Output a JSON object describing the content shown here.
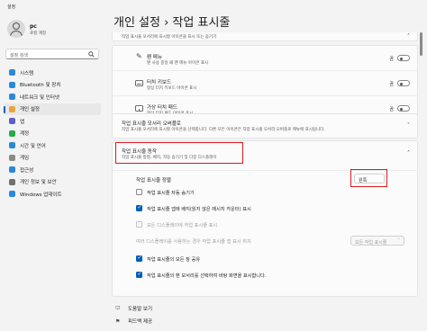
{
  "window": {
    "title": "설정"
  },
  "profile": {
    "name": "pc",
    "type": "로컬 계정"
  },
  "search": {
    "placeholder": "설정 검색"
  },
  "nav": [
    {
      "label": "시스템",
      "color": "#2b88d8"
    },
    {
      "label": "Bluetooth 및 장치",
      "color": "#2b88d8"
    },
    {
      "label": "네트워크 및 인터넷",
      "color": "#2b88d8"
    },
    {
      "label": "개인 설정",
      "color": "#e8a33d",
      "active": true
    },
    {
      "label": "앱",
      "color": "#5b5fc7"
    },
    {
      "label": "계정",
      "color": "#2aa84a"
    },
    {
      "label": "시간 및 언어",
      "color": "#2b88d8"
    },
    {
      "label": "게임",
      "color": "#8a8a8a"
    },
    {
      "label": "접근성",
      "color": "#2b88d8"
    },
    {
      "label": "개인 정보 및 보안",
      "color": "#707070"
    },
    {
      "label": "Windows 업데이트",
      "color": "#2b88d8"
    }
  ],
  "page": {
    "title": "개인 설정  ›  작업 표시줄"
  },
  "top_partial": {
    "text": "작업 표시줄 모서리에 표시할 아이콘을 표시 또는 숨기기"
  },
  "corner_icons": [
    {
      "title": "펜 메뉴",
      "desc": "펜 사용 중일 때 펜 메뉴 아이콘 표시",
      "state": "끔"
    },
    {
      "title": "터치 키보드",
      "desc": "항상 터치 키보드 아이콘 표시",
      "state": "끔"
    },
    {
      "title": "가상 터치 패드",
      "desc": "항상 터치 패드 아이콘 표시",
      "state": "끔"
    }
  ],
  "overflow": {
    "title": "작업 표시줄 모서리 오버플로",
    "desc": "작업 표시줄 모서리에 표시할 아이콘을 선택합니다. 다른 모든 아이콘은 작업 표시줄 모서리 오버플로 메뉴에 표시됩니다."
  },
  "behavior": {
    "title": "작업 표시줄 동작",
    "desc": "작업 표시줄 정렬, 배지, 자동 숨기기 및 다중 디스플레이",
    "alignment_label": "작업 표시줄 정렬",
    "alignment_value": "왼쪽",
    "options": [
      {
        "label": "작업 표시줄 자동 숨기기",
        "checked": false,
        "disabled": false
      },
      {
        "label": "작업 표시줄 앱에 배지(읽지 않은 메시지 카운터) 표시",
        "checked": true,
        "disabled": false
      },
      {
        "label": "모든 디스플레이에 작업 표시줄 표시",
        "checked": false,
        "disabled": true
      }
    ],
    "multi_label": "여러 디스플레이를 사용하는 경우 작업 표시줄 앱 표시 위치",
    "multi_value": "모든 작업 표시줄",
    "options2": [
      {
        "label": "작업 표시줄의 모든 창 공유",
        "checked": true,
        "disabled": false
      },
      {
        "label": "작업 표시줄의 맨 모서리를 선택하여 바탕 화면을 표시합니다.",
        "checked": true,
        "disabled": false
      }
    ]
  },
  "footer": [
    {
      "label": "도움말 보기",
      "icon": "help-icon"
    },
    {
      "label": "피드백 제공",
      "icon": "feedback-icon"
    }
  ]
}
